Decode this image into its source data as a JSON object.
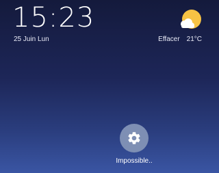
{
  "lockscreen": {
    "time": "15:23",
    "date": "25 Juin Lun"
  },
  "weather": {
    "icon": "partly-sunny-icon",
    "condition": "Effacer",
    "temperature": "21°C"
  },
  "apps": [
    {
      "label": "Impossible..",
      "icon": "gear-icon",
      "color": "#7e8fb4"
    }
  ],
  "colors": {
    "background_top": "#141a3c",
    "background_bottom": "#3a55a3",
    "sun": "#f7c344"
  }
}
